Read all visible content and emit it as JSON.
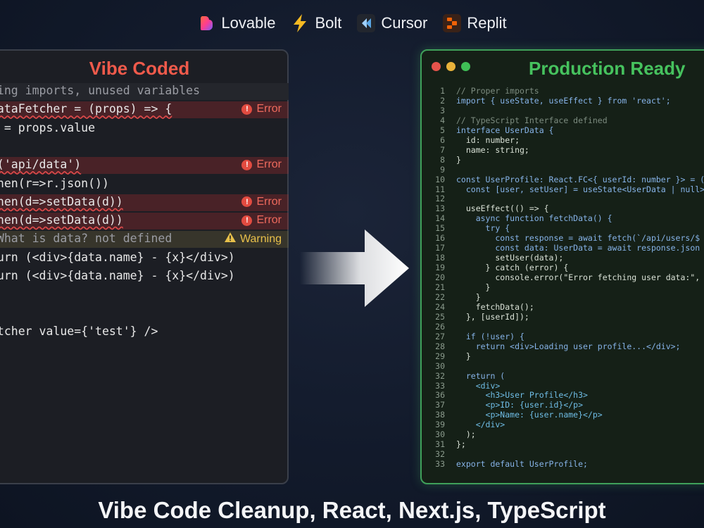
{
  "brands": [
    {
      "name": "Lovable",
      "icon": "heart-gradient-icon"
    },
    {
      "name": "Bolt",
      "icon": "lightning-icon"
    },
    {
      "name": "Cursor",
      "icon": "cursor-icon"
    },
    {
      "name": "Replit",
      "icon": "replit-icon"
    }
  ],
  "left_panel": {
    "title": "Vibe Coded",
    "lines": [
      {
        "text": "sing imports, unused variables",
        "kind": "comment"
      },
      {
        "text": "DataFetcher = (props) => {",
        "kind": "error",
        "badge": "Error"
      },
      {
        "text": "x = props.value",
        "kind": "plain"
      },
      {
        "text": "",
        "kind": "plain"
      },
      {
        "text": "h('api/data')",
        "kind": "error",
        "badge": "Error"
      },
      {
        "text": "then(r=>r.json())",
        "kind": "plain"
      },
      {
        "text": "then(d=>setData(d))",
        "kind": "error",
        "badge": "Error"
      },
      {
        "text": "then(d=>setData(d))",
        "kind": "error",
        "badge": "Error"
      },
      {
        "text": " What is data? not defined",
        "kind": "warning",
        "badge": "Warning"
      },
      {
        "text": "turn (<div>{data.name} - {x}</div>)",
        "kind": "plain"
      },
      {
        "text": "turn (<div>{data.name} - {x}</div>)",
        "kind": "plain"
      },
      {
        "text": "",
        "kind": "plain"
      },
      {
        "text": "",
        "kind": "plain"
      },
      {
        "text": "etcher value={'test'} />",
        "kind": "plain"
      }
    ]
  },
  "right_panel": {
    "title": "Production Ready",
    "window_dots": [
      "#e5534b",
      "#e8b33a",
      "#3fbf56"
    ],
    "lines": [
      {
        "n": "1",
        "text": "// Proper imports"
      },
      {
        "n": "2",
        "text": "import { useState, useEffect } from 'react';"
      },
      {
        "n": "3",
        "text": ""
      },
      {
        "n": "4",
        "text": "// TypeScript Interface defined"
      },
      {
        "n": "5",
        "text": "interface UserData {"
      },
      {
        "n": "6",
        "text": "  id: number;"
      },
      {
        "n": "7",
        "text": "  name: string;"
      },
      {
        "n": "8",
        "text": "}"
      },
      {
        "n": "9",
        "text": ""
      },
      {
        "n": "10",
        "text": "const UserProfile: React.FC<{ userId: number }> = ("
      },
      {
        "n": "11",
        "text": "  const [user, setUser] = useState<UserData | null>"
      },
      {
        "n": "12",
        "text": ""
      },
      {
        "n": "13",
        "text": "  useEffect(() => {"
      },
      {
        "n": "14",
        "text": "    async function fetchData() {"
      },
      {
        "n": "15",
        "text": "      try {"
      },
      {
        "n": "16",
        "text": "        const response = await fetch(`/api/users/$"
      },
      {
        "n": "17",
        "text": "        const data: UserData = await response.json"
      },
      {
        "n": "18",
        "text": "        setUser(data);"
      },
      {
        "n": "19",
        "text": "      } catch (error) {"
      },
      {
        "n": "20",
        "text": "        console.error(\"Error fetching user data:\","
      },
      {
        "n": "21",
        "text": "      }"
      },
      {
        "n": "22",
        "text": "    }"
      },
      {
        "n": "24",
        "text": "    fetchData();"
      },
      {
        "n": "25",
        "text": "  }, [userId]);"
      },
      {
        "n": "26",
        "text": ""
      },
      {
        "n": "27",
        "text": "  if (!user) {"
      },
      {
        "n": "28",
        "text": "    return <div>Loading user profile...</div>;"
      },
      {
        "n": "29",
        "text": "  }"
      },
      {
        "n": "30",
        "text": ""
      },
      {
        "n": "32",
        "text": "  return ("
      },
      {
        "n": "33",
        "text": "    <div>"
      },
      {
        "n": "36",
        "text": "      <h3>User Profile</h3>"
      },
      {
        "n": "37",
        "text": "      <p>ID: {user.id}</p>"
      },
      {
        "n": "38",
        "text": "      <p>Name: {user.name}</p>"
      },
      {
        "n": "39",
        "text": "    </div>"
      },
      {
        "n": "30",
        "text": "  );"
      },
      {
        "n": "31",
        "text": "};"
      },
      {
        "n": "32",
        "text": ""
      },
      {
        "n": "33",
        "text": "export default UserProfile;"
      }
    ]
  },
  "headline": "Vibe Code Cleanup, React, Next.js, TypeScript",
  "colors": {
    "error": "#ef5a4b",
    "success": "#46c25e",
    "warning": "#e8c04a"
  }
}
